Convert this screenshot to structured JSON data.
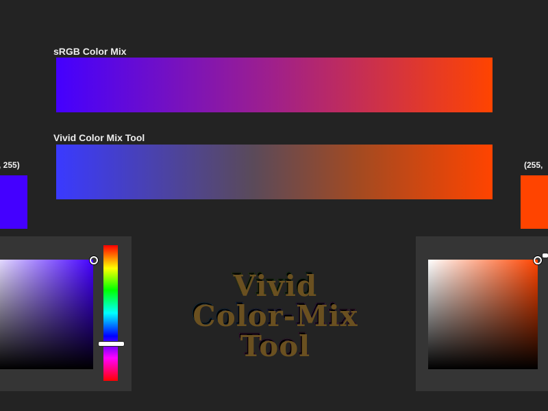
{
  "srgb_label": "sRGB Color Mix",
  "vivid_label": "Vivid Color Mix Tool",
  "left_swatch": {
    "rgb_text": ", 255)",
    "color": "#4400ff"
  },
  "right_swatch": {
    "rgb_text": "(255,",
    "color": "#ff4400"
  },
  "title": {
    "line1": "Vivid",
    "line2": "Color-Mix",
    "line3": "Tool"
  },
  "colors": {
    "background": "#232323",
    "panel": "#353535",
    "color_a": "#4400ff",
    "color_b": "#ff4400"
  }
}
